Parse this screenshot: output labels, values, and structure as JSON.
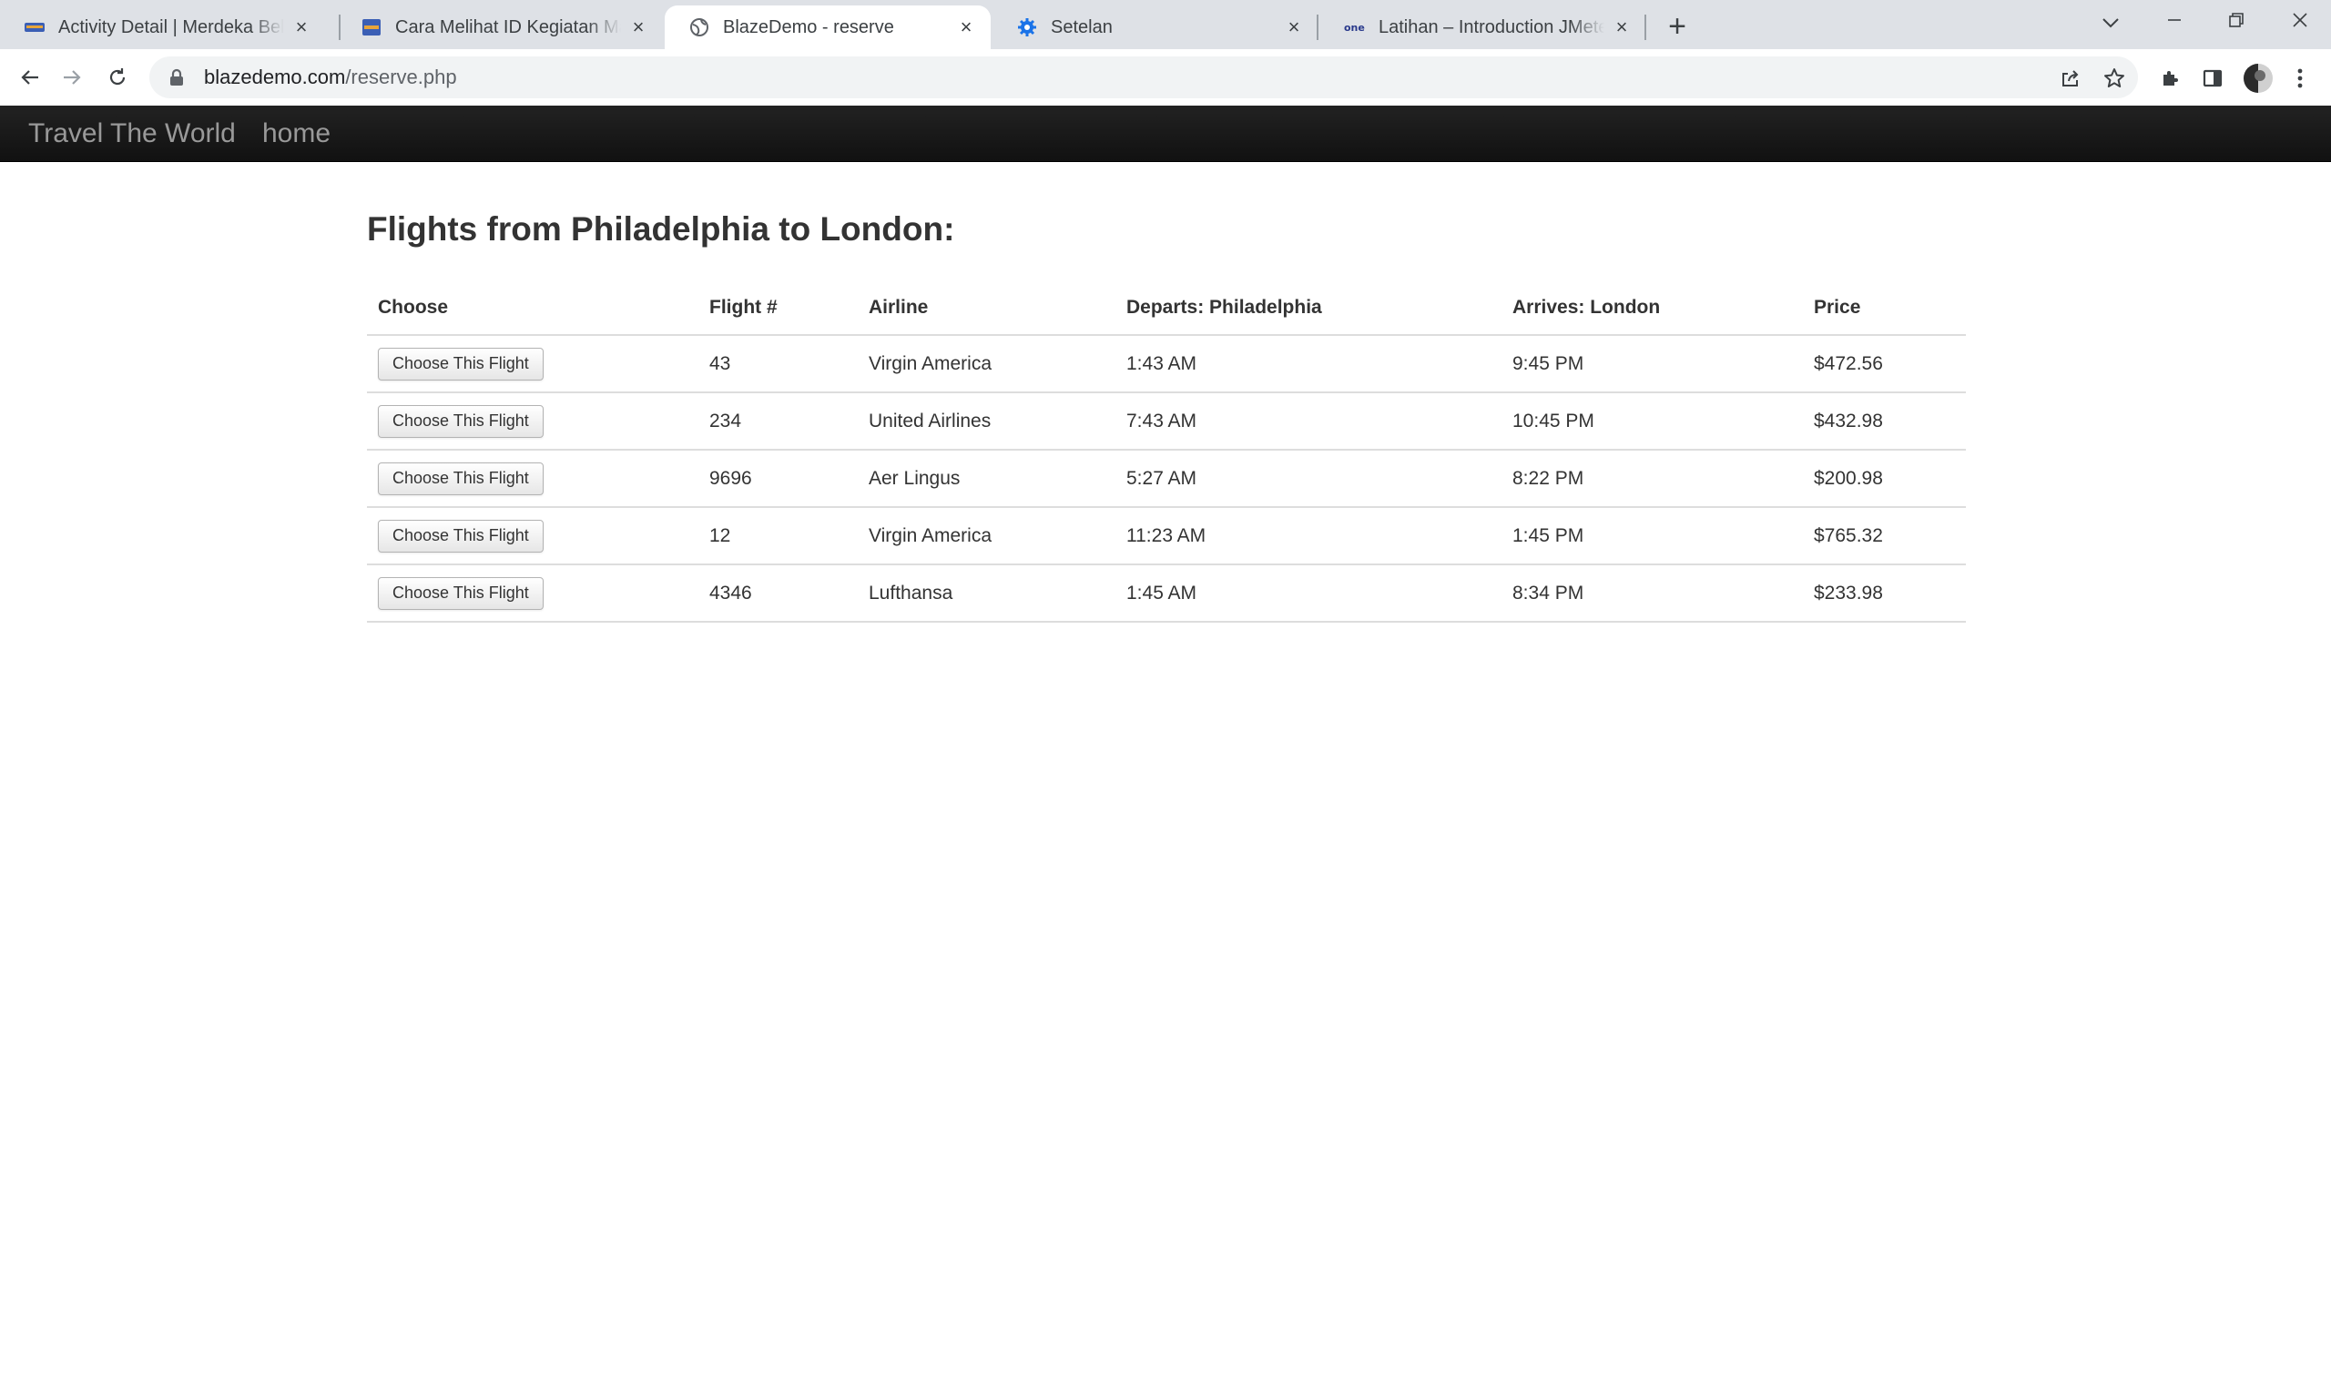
{
  "browser": {
    "tabs": [
      {
        "title": "Activity Detail | Merdeka Belajar",
        "active": false,
        "favicon": "kampus-merdeka-icon"
      },
      {
        "title": "Cara Melihat ID Kegiatan Mahasiswa",
        "active": false,
        "favicon": "kampus-merdeka-icon"
      },
      {
        "title": "BlazeDemo - reserve",
        "active": true,
        "favicon": "globe-icon"
      },
      {
        "title": "Setelan",
        "active": false,
        "favicon": "gear-icon"
      },
      {
        "title": "Latihan – Introduction JMeter and",
        "active": false,
        "favicon": "one-icon"
      }
    ],
    "url_domain": "blazedemo.com",
    "url_path": "/reserve.php"
  },
  "navbar": {
    "brand": "Travel The World",
    "home": "home"
  },
  "page": {
    "title": "Flights from Philadelphia to London:",
    "columns": [
      "Choose",
      "Flight #",
      "Airline",
      "Departs: Philadelphia",
      "Arrives: London",
      "Price"
    ],
    "button_label": "Choose This Flight",
    "flights": [
      {
        "flight": "43",
        "airline": "Virgin America",
        "departs": "1:43 AM",
        "arrives": "9:45 PM",
        "price": "$472.56"
      },
      {
        "flight": "234",
        "airline": "United Airlines",
        "departs": "7:43 AM",
        "arrives": "10:45 PM",
        "price": "$432.98"
      },
      {
        "flight": "9696",
        "airline": "Aer Lingus",
        "departs": "5:27 AM",
        "arrives": "8:22 PM",
        "price": "$200.98"
      },
      {
        "flight": "12",
        "airline": "Virgin America",
        "departs": "11:23 AM",
        "arrives": "1:45 PM",
        "price": "$765.32"
      },
      {
        "flight": "4346",
        "airline": "Lufthansa",
        "departs": "1:45 AM",
        "arrives": "8:34 PM",
        "price": "$233.98"
      }
    ]
  }
}
